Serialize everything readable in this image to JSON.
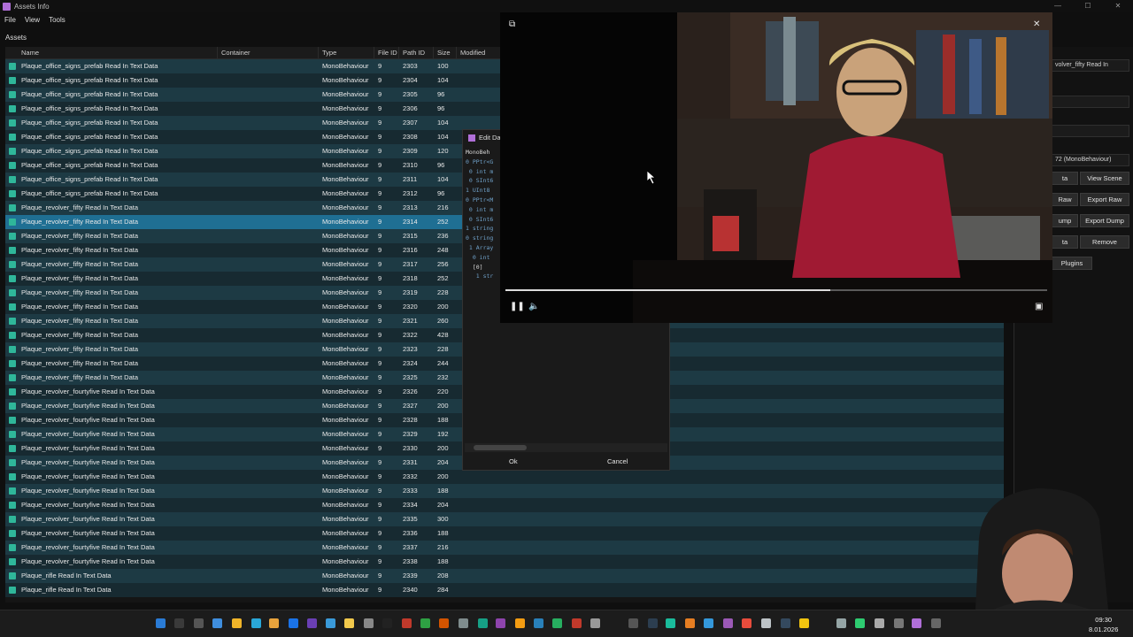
{
  "window": {
    "title": "Assets Info"
  },
  "menu": [
    "File",
    "View",
    "Tools"
  ],
  "section_label": "Assets",
  "columns": [
    "Name",
    "Container",
    "Type",
    "File ID",
    "Path ID",
    "Size",
    "Modified"
  ],
  "rows": [
    {
      "name": "Plaque_office_signs_prefab Read In Text Data",
      "type": "MonoBehaviour",
      "file_id": "9",
      "path_id": "2303",
      "size": "100",
      "selected": false
    },
    {
      "name": "Plaque_office_signs_prefab Read In Text Data",
      "type": "MonoBehaviour",
      "file_id": "9",
      "path_id": "2304",
      "size": "104",
      "selected": false
    },
    {
      "name": "Plaque_office_signs_prefab Read In Text Data",
      "type": "MonoBehaviour",
      "file_id": "9",
      "path_id": "2305",
      "size": "96",
      "selected": false
    },
    {
      "name": "Plaque_office_signs_prefab Read In Text Data",
      "type": "MonoBehaviour",
      "file_id": "9",
      "path_id": "2306",
      "size": "96",
      "selected": false
    },
    {
      "name": "Plaque_office_signs_prefab Read In Text Data",
      "type": "MonoBehaviour",
      "file_id": "9",
      "path_id": "2307",
      "size": "104",
      "selected": false
    },
    {
      "name": "Plaque_office_signs_prefab Read In Text Data",
      "type": "MonoBehaviour",
      "file_id": "9",
      "path_id": "2308",
      "size": "104",
      "selected": false
    },
    {
      "name": "Plaque_office_signs_prefab Read In Text Data",
      "type": "MonoBehaviour",
      "file_id": "9",
      "path_id": "2309",
      "size": "120",
      "selected": false
    },
    {
      "name": "Plaque_office_signs_prefab Read In Text Data",
      "type": "MonoBehaviour",
      "file_id": "9",
      "path_id": "2310",
      "size": "96",
      "selected": false
    },
    {
      "name": "Plaque_office_signs_prefab Read In Text Data",
      "type": "MonoBehaviour",
      "file_id": "9",
      "path_id": "2311",
      "size": "104",
      "selected": false
    },
    {
      "name": "Plaque_office_signs_prefab Read In Text Data",
      "type": "MonoBehaviour",
      "file_id": "9",
      "path_id": "2312",
      "size": "96",
      "selected": false
    },
    {
      "name": "Plaque_revolver_fifty Read In Text Data",
      "type": "MonoBehaviour",
      "file_id": "9",
      "path_id": "2313",
      "size": "216",
      "selected": false
    },
    {
      "name": "Plaque_revolver_fifty Read In Text Data",
      "type": "MonoBehaviour",
      "file_id": "9",
      "path_id": "2314",
      "size": "252",
      "selected": true
    },
    {
      "name": "Plaque_revolver_fifty Read In Text Data",
      "type": "MonoBehaviour",
      "file_id": "9",
      "path_id": "2315",
      "size": "236",
      "selected": false
    },
    {
      "name": "Plaque_revolver_fifty Read In Text Data",
      "type": "MonoBehaviour",
      "file_id": "9",
      "path_id": "2316",
      "size": "248",
      "selected": false
    },
    {
      "name": "Plaque_revolver_fifty Read In Text Data",
      "type": "MonoBehaviour",
      "file_id": "9",
      "path_id": "2317",
      "size": "256",
      "selected": false
    },
    {
      "name": "Plaque_revolver_fifty Read In Text Data",
      "type": "MonoBehaviour",
      "file_id": "9",
      "path_id": "2318",
      "size": "252",
      "selected": false
    },
    {
      "name": "Plaque_revolver_fifty Read In Text Data",
      "type": "MonoBehaviour",
      "file_id": "9",
      "path_id": "2319",
      "size": "228",
      "selected": false
    },
    {
      "name": "Plaque_revolver_fifty Read In Text Data",
      "type": "MonoBehaviour",
      "file_id": "9",
      "path_id": "2320",
      "size": "200",
      "selected": false
    },
    {
      "name": "Plaque_revolver_fifty Read In Text Data",
      "type": "MonoBehaviour",
      "file_id": "9",
      "path_id": "2321",
      "size": "260",
      "selected": false
    },
    {
      "name": "Plaque_revolver_fifty Read In Text Data",
      "type": "MonoBehaviour",
      "file_id": "9",
      "path_id": "2322",
      "size": "428",
      "selected": false
    },
    {
      "name": "Plaque_revolver_fifty Read In Text Data",
      "type": "MonoBehaviour",
      "file_id": "9",
      "path_id": "2323",
      "size": "228",
      "selected": false
    },
    {
      "name": "Plaque_revolver_fifty Read In Text Data",
      "type": "MonoBehaviour",
      "file_id": "9",
      "path_id": "2324",
      "size": "244",
      "selected": false
    },
    {
      "name": "Plaque_revolver_fifty Read In Text Data",
      "type": "MonoBehaviour",
      "file_id": "9",
      "path_id": "2325",
      "size": "232",
      "selected": false
    },
    {
      "name": "Plaque_revolver_fourtyfive Read In Text Data",
      "type": "MonoBehaviour",
      "file_id": "9",
      "path_id": "2326",
      "size": "220",
      "selected": false
    },
    {
      "name": "Plaque_revolver_fourtyfive Read In Text Data",
      "type": "MonoBehaviour",
      "file_id": "9",
      "path_id": "2327",
      "size": "200",
      "selected": false
    },
    {
      "name": "Plaque_revolver_fourtyfive Read In Text Data",
      "type": "MonoBehaviour",
      "file_id": "9",
      "path_id": "2328",
      "size": "188",
      "selected": false
    },
    {
      "name": "Plaque_revolver_fourtyfive Read In Text Data",
      "type": "MonoBehaviour",
      "file_id": "9",
      "path_id": "2329",
      "size": "192",
      "selected": false
    },
    {
      "name": "Plaque_revolver_fourtyfive Read In Text Data",
      "type": "MonoBehaviour",
      "file_id": "9",
      "path_id": "2330",
      "size": "200",
      "selected": false
    },
    {
      "name": "Plaque_revolver_fourtyfive Read In Text Data",
      "type": "MonoBehaviour",
      "file_id": "9",
      "path_id": "2331",
      "size": "204",
      "selected": false
    },
    {
      "name": "Plaque_revolver_fourtyfive Read In Text Data",
      "type": "MonoBehaviour",
      "file_id": "9",
      "path_id": "2332",
      "size": "200",
      "selected": false
    },
    {
      "name": "Plaque_revolver_fourtyfive Read In Text Data",
      "type": "MonoBehaviour",
      "file_id": "9",
      "path_id": "2333",
      "size": "188",
      "selected": false
    },
    {
      "name": "Plaque_revolver_fourtyfive Read In Text Data",
      "type": "MonoBehaviour",
      "file_id": "9",
      "path_id": "2334",
      "size": "204",
      "selected": false
    },
    {
      "name": "Plaque_revolver_fourtyfive Read In Text Data",
      "type": "MonoBehaviour",
      "file_id": "9",
      "path_id": "2335",
      "size": "300",
      "selected": false
    },
    {
      "name": "Plaque_revolver_fourtyfive Read In Text Data",
      "type": "MonoBehaviour",
      "file_id": "9",
      "path_id": "2336",
      "size": "188",
      "selected": false
    },
    {
      "name": "Plaque_revolver_fourtyfive Read In Text Data",
      "type": "MonoBehaviour",
      "file_id": "9",
      "path_id": "2337",
      "size": "216",
      "selected": false
    },
    {
      "name": "Plaque_revolver_fourtyfive Read In Text Data",
      "type": "MonoBehaviour",
      "file_id": "9",
      "path_id": "2338",
      "size": "188",
      "selected": false
    },
    {
      "name": "Plaque_rifle Read In Text Data",
      "type": "MonoBehaviour",
      "file_id": "9",
      "path_id": "2339",
      "size": "208",
      "selected": false
    },
    {
      "name": "Plaque_rifle Read In Text Data",
      "type": "MonoBehaviour",
      "file_id": "9",
      "path_id": "2340",
      "size": "284",
      "selected": false
    }
  ],
  "right_panel": {
    "name_field": "volver_fifty Read In",
    "type_field": "72 (MonoBehaviour)",
    "buttons": {
      "view_scene": "View Scene",
      "export_raw": "Export Raw",
      "export_dump": "Export Dump",
      "remove": "Remove",
      "plugins": "Plugins",
      "data": "ta",
      "raw": "Raw",
      "dump": "ump",
      "more": "ta"
    }
  },
  "edit_dialog": {
    "title": "Edit Da",
    "tree": [
      "MonoBeh",
      "0 PPtr<G",
      " 0 int m",
      " 0 SInt6",
      "1 UInt8",
      "0 PPtr<M",
      " 0 int m",
      " 0 SInt6",
      "1 string",
      "0 string",
      " 1 Array",
      "  0 int",
      "  [0]",
      "   1 str"
    ],
    "ok_label": "Ok",
    "cancel_label": "Cancel"
  },
  "video": {
    "progress": 0.6,
    "paused": false
  },
  "taskbar": {
    "time": "09:30",
    "date": "8.01.2026"
  },
  "colors": {
    "row_dark": "#172a31",
    "row_light": "#1d3a44",
    "row_selected": "#1f6f93",
    "asset_icon": "#2fb79a"
  }
}
